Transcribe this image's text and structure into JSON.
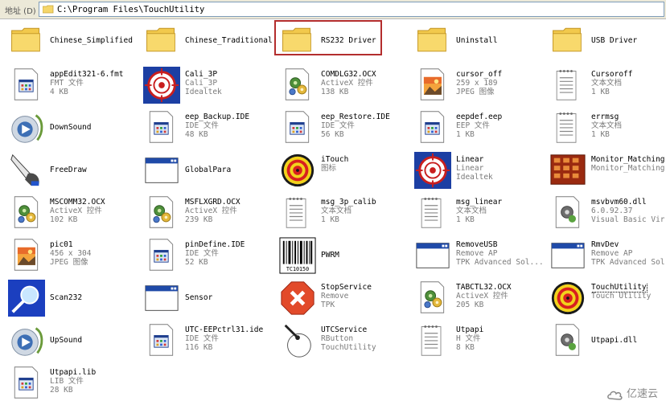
{
  "address_bar": {
    "label": "地址 (D)",
    "path": "C:\\Program Files\\TouchUtility"
  },
  "files": [
    {
      "name": "Chinese_Simplified",
      "icon": "folder-icon",
      "meta": []
    },
    {
      "name": "Chinese_Traditional",
      "icon": "folder-icon",
      "meta": []
    },
    {
      "name": "RS232 Driver",
      "icon": "folder-icon",
      "meta": [],
      "highlighted": true
    },
    {
      "name": "Uninstall",
      "icon": "folder-icon",
      "meta": []
    },
    {
      "name": "USB Driver",
      "icon": "folder-icon",
      "meta": []
    },
    {
      "name": "appEdit321-6.fmt",
      "icon": "generic-file-icon",
      "meta": [
        "FMT 文件",
        "4 KB"
      ]
    },
    {
      "name": "Cali_3P",
      "icon": "target-app-icon",
      "meta": [
        "Cali_3P",
        "Idealtek"
      ]
    },
    {
      "name": "COMDLG32.OCX",
      "icon": "activex-icon",
      "meta": [
        "ActiveX 控件",
        "138 KB"
      ]
    },
    {
      "name": "cursor_off",
      "icon": "image-file-icon",
      "meta": [
        "259 x 189",
        "JPEG 图像"
      ]
    },
    {
      "name": "Cursoroff",
      "icon": "text-file-icon",
      "meta": [
        "文本文档",
        "1 KB"
      ]
    },
    {
      "name": "DownSound",
      "icon": "media-icon",
      "meta": []
    },
    {
      "name": "eep_Backup.IDE",
      "icon": "generic-file-icon",
      "meta": [
        "IDE 文件",
        "48 KB"
      ]
    },
    {
      "name": "eep_Restore.IDE",
      "icon": "generic-file-icon",
      "meta": [
        "IDE 文件",
        "56 KB"
      ]
    },
    {
      "name": "eepdef.eep",
      "icon": "generic-file-icon",
      "meta": [
        "EEP 文件",
        "1 KB"
      ]
    },
    {
      "name": "errmsg",
      "icon": "text-file-icon",
      "meta": [
        "文本文档",
        "1 KB"
      ]
    },
    {
      "name": "FreeDraw",
      "icon": "pen-hand-icon",
      "meta": []
    },
    {
      "name": "GlobalPara",
      "icon": "window-app-icon",
      "meta": []
    },
    {
      "name": "iTouch",
      "icon": "target-icon",
      "meta": [
        "图标"
      ]
    },
    {
      "name": "Linear",
      "icon": "target-app-icon",
      "meta": [
        "Linear",
        "Idealtek"
      ]
    },
    {
      "name": "Monitor_Matching",
      "icon": "grid-app-icon",
      "meta": [
        "Monitor_Matching"
      ]
    },
    {
      "name": "MSCOMM32.OCX",
      "icon": "activex-icon",
      "meta": [
        "ActiveX 控件",
        "102 KB"
      ]
    },
    {
      "name": "MSFLXGRD.OCX",
      "icon": "activex-icon",
      "meta": [
        "ActiveX 控件",
        "239 KB"
      ]
    },
    {
      "name": "msg_3p_calib",
      "icon": "text-file-icon",
      "meta": [
        "文本文档",
        "1 KB"
      ]
    },
    {
      "name": "msg_linear",
      "icon": "text-file-icon",
      "meta": [
        "文本文档",
        "1 KB"
      ]
    },
    {
      "name": "msvbvm60.dll",
      "icon": "dll-icon",
      "meta": [
        "6.0.92.37",
        "Visual Basic Vir..."
      ]
    },
    {
      "name": "pic01",
      "icon": "image-file-icon",
      "meta": [
        "456 x 304",
        "JPEG 图像"
      ]
    },
    {
      "name": "pinDefine.IDE",
      "icon": "generic-file-icon",
      "meta": [
        "IDE 文件",
        "52 KB"
      ]
    },
    {
      "name": "PWRM",
      "icon": "barcode-icon",
      "meta": [],
      "barcode_text": "TC10150"
    },
    {
      "name": "RemoveUSB",
      "icon": "window-app-icon",
      "meta": [
        "Remove AP",
        "TPK Advanced Sol..."
      ]
    },
    {
      "name": "RmvDev",
      "icon": "window-app-icon",
      "meta": [
        "Remove AP",
        "TPK Advanced Sol..."
      ]
    },
    {
      "name": "Scan232",
      "icon": "scan-icon",
      "meta": []
    },
    {
      "name": "Sensor",
      "icon": "window-app-icon",
      "meta": []
    },
    {
      "name": "StopService",
      "icon": "stop-x-icon",
      "meta": [
        "Remove",
        "TPK"
      ]
    },
    {
      "name": "TABCTL32.OCX",
      "icon": "activex-icon",
      "meta": [
        "ActiveX 控件",
        "205 KB"
      ]
    },
    {
      "name": "TouchUtility",
      "icon": "target-icon",
      "meta": [
        "Touch Utility"
      ],
      "focused": true
    },
    {
      "name": "UpSound",
      "icon": "media-icon",
      "meta": []
    },
    {
      "name": "UTC-EEPctrl31.ide",
      "icon": "generic-file-icon",
      "meta": [
        "IDE 文件",
        "116 KB"
      ]
    },
    {
      "name": "UTCService",
      "icon": "service-icon",
      "meta": [
        "RButton",
        "TouchUtility"
      ]
    },
    {
      "name": "Utpapi",
      "icon": "text-file-icon",
      "meta": [
        "H 文件",
        "8 KB"
      ]
    },
    {
      "name": "Utpapi.dll",
      "icon": "dll-icon",
      "meta": []
    },
    {
      "name": "Utpapi.lib",
      "icon": "generic-file-icon",
      "meta": [
        "LIB 文件",
        "28 KB"
      ]
    }
  ],
  "watermark": "亿速云"
}
